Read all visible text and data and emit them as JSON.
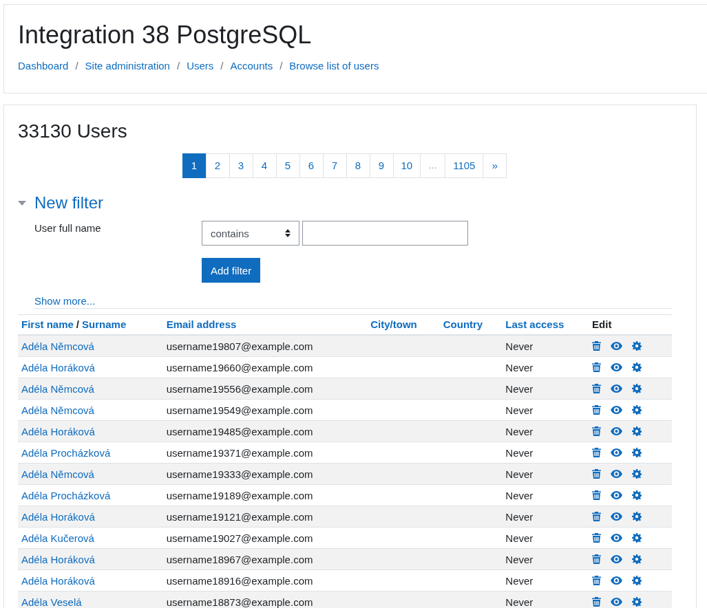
{
  "site_title": "Integration 38 PostgreSQL",
  "breadcrumbs": [
    {
      "label": "Dashboard"
    },
    {
      "separator": "/",
      "label": "Site administration"
    },
    {
      "separator": "/",
      "label": "Users"
    },
    {
      "separator": "/",
      "label": "Accounts"
    },
    {
      "separator": "/",
      "label": "Browse list of users"
    }
  ],
  "heading": "33130 Users",
  "pagination": [
    {
      "label": "1",
      "selected": true,
      "kind": "page"
    },
    {
      "label": "2",
      "selected": false,
      "kind": "page"
    },
    {
      "label": "3",
      "selected": false,
      "kind": "page"
    },
    {
      "label": "4",
      "selected": false,
      "kind": "page"
    },
    {
      "label": "5",
      "selected": false,
      "kind": "page"
    },
    {
      "label": "6",
      "selected": false,
      "kind": "page"
    },
    {
      "label": "7",
      "selected": false,
      "kind": "page"
    },
    {
      "label": "8",
      "selected": false,
      "kind": "page"
    },
    {
      "label": "9",
      "selected": false,
      "kind": "page"
    },
    {
      "label": "10",
      "selected": false,
      "kind": "page"
    },
    {
      "label": "…",
      "selected": false,
      "kind": "gap"
    },
    {
      "label": "1105",
      "selected": false,
      "kind": "page"
    },
    {
      "label": "»",
      "selected": false,
      "kind": "page"
    }
  ],
  "filter": {
    "title": "New filter",
    "expanded": true,
    "field_label": "User full name",
    "operator": "contains",
    "add_button": "Add filter",
    "show_more": "Show more..."
  },
  "table": {
    "columns": [
      {
        "parts": [
          "First name",
          "/",
          "Surname"
        ],
        "sortable": true
      },
      {
        "parts": [
          "Email address"
        ],
        "sortable": true
      },
      {
        "parts": [
          "City/town"
        ],
        "sortable": true
      },
      {
        "parts": [
          "Country"
        ],
        "sortable": true
      },
      {
        "parts": [
          "Last access"
        ],
        "sortable": true
      },
      {
        "parts": [
          "Edit"
        ],
        "sortable": false
      }
    ],
    "rows": [
      {
        "name": "Adéla Němcová",
        "email": "username19807@example.com",
        "last_access": "Never"
      },
      {
        "name": "Adéla Horáková",
        "email": "username19660@example.com",
        "last_access": "Never"
      },
      {
        "name": "Adéla Němcová",
        "email": "username19556@example.com",
        "last_access": "Never"
      },
      {
        "name": "Adéla Němcová",
        "email": "username19549@example.com",
        "last_access": "Never"
      },
      {
        "name": "Adéla Horáková",
        "email": "username19485@example.com",
        "last_access": "Never"
      },
      {
        "name": "Adéla Procházková",
        "email": "username19371@example.com",
        "last_access": "Never"
      },
      {
        "name": "Adéla Němcová",
        "email": "username19333@example.com",
        "last_access": "Never"
      },
      {
        "name": "Adéla Procházková",
        "email": "username19189@example.com",
        "last_access": "Never"
      },
      {
        "name": "Adéla Horáková",
        "email": "username19121@example.com",
        "last_access": "Never"
      },
      {
        "name": "Adéla Kučerová",
        "email": "username19027@example.com",
        "last_access": "Never"
      },
      {
        "name": "Adéla Horáková",
        "email": "username18967@example.com",
        "last_access": "Never"
      },
      {
        "name": "Adéla Horáková",
        "email": "username18916@example.com",
        "last_access": "Never"
      },
      {
        "name": "Adéla Veselá",
        "email": "username18873@example.com",
        "last_access": "Never"
      }
    ]
  }
}
